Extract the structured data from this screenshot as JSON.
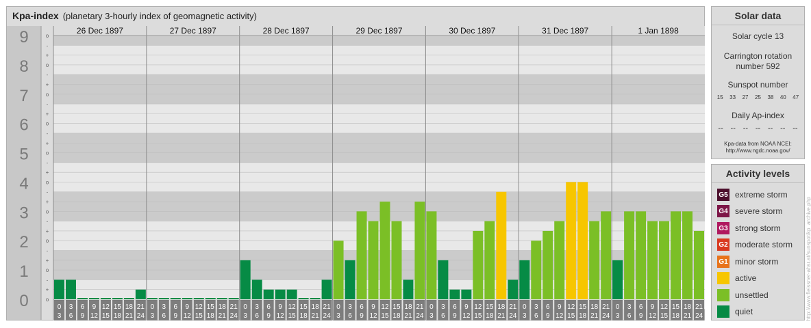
{
  "header": {
    "title": "Kpa-index",
    "subtitle": "(planetary 3-hourly index of geomagnetic activity)"
  },
  "chart_data": {
    "type": "bar",
    "title": "Kpa-index",
    "subtitle": "(planetary 3-hourly index of geomagnetic activity)",
    "ylim": [
      0,
      9.3333
    ],
    "y_ticks": [
      "0",
      "1",
      "2",
      "3",
      "4",
      "5",
      "6",
      "7",
      "8",
      "9"
    ],
    "y_subticks": [
      "+",
      "o",
      "-"
    ],
    "days": [
      "26 Dec 1897",
      "27 Dec 1897",
      "28 Dec 1897",
      "29 Dec 1897",
      "30 Dec 1897",
      "31 Dec 1897",
      "1 Jan 1898"
    ],
    "hour_labels": [
      [
        "0",
        "3"
      ],
      [
        "3",
        "6"
      ],
      [
        "6",
        "9"
      ],
      [
        "9",
        "12"
      ],
      [
        "12",
        "15"
      ],
      [
        "15",
        "18"
      ],
      [
        "18",
        "21"
      ],
      [
        "21",
        "24"
      ]
    ],
    "values": [
      0.667,
      0.667,
      0,
      0,
      0,
      0,
      0,
      0.333,
      0,
      0,
      0,
      0,
      0,
      0,
      0,
      0,
      1.333,
      0.667,
      0.333,
      0.333,
      0.333,
      0,
      0,
      0.667,
      2,
      1.333,
      3,
      2.667,
      3.333,
      2.667,
      0.667,
      3.333,
      3,
      1.333,
      0.333,
      0.333,
      2.333,
      2.667,
      3.667,
      0.667,
      1.333,
      2,
      2.333,
      2.667,
      4,
      4,
      2.667,
      3,
      1.333,
      3,
      3,
      2.667,
      2.667,
      3,
      3,
      2.333
    ],
    "grid": true,
    "legend": "right"
  },
  "solar": {
    "header": "Solar data",
    "cycle": "Solar cycle 13",
    "carrington": [
      "Carrington rotation",
      "number 592"
    ],
    "sunspot_label": "Sunspot number",
    "sunspot_values": [
      "15",
      "33",
      "27",
      "25",
      "38",
      "40",
      "47"
    ],
    "ap_label": "Daily Ap-index",
    "ap_values": [
      "--",
      "--",
      "--",
      "--",
      "--",
      "--",
      "--"
    ],
    "source": [
      "Kpa-data from NOAA NCEI:",
      "http://www.ngdc.noaa.gov/"
    ]
  },
  "activity": {
    "header": "Activity levels",
    "levels": [
      {
        "badge": "G5",
        "label": "extreme storm",
        "color": "#4c0f2c"
      },
      {
        "badge": "G4",
        "label": "severe storm",
        "color": "#7d1647"
      },
      {
        "badge": "G3",
        "label": "strong storm",
        "color": "#b0195f"
      },
      {
        "badge": "G2",
        "label": "moderate storm",
        "color": "#d9391f"
      },
      {
        "badge": "G1",
        "label": "minor storm",
        "color": "#e8731a"
      },
      {
        "badge": "",
        "label": "active",
        "color": "#f7c600"
      },
      {
        "badge": "",
        "label": "unsettled",
        "color": "#7bbf26"
      },
      {
        "badge": "",
        "label": "quiet",
        "color": "#068b45"
      }
    ]
  },
  "credit": "http://www.fleissner-ahsr.at/sunspot/kp_archive.php"
}
